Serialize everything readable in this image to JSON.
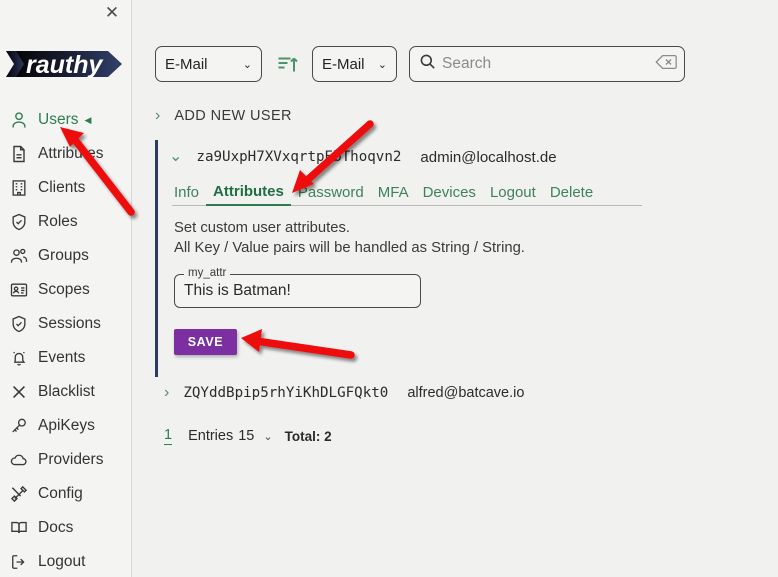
{
  "window": {
    "close_label": "✕"
  },
  "sidebar": {
    "logo_text": "rauthy",
    "items": [
      {
        "label": "Users",
        "icon": "user-icon",
        "active": true
      },
      {
        "label": "Attributes",
        "icon": "document-icon",
        "active": false
      },
      {
        "label": "Clients",
        "icon": "building-icon",
        "active": false
      },
      {
        "label": "Roles",
        "icon": "shield-check-icon",
        "active": false
      },
      {
        "label": "Groups",
        "icon": "users-icon",
        "active": false
      },
      {
        "label": "Scopes",
        "icon": "id-card-icon",
        "active": false
      },
      {
        "label": "Sessions",
        "icon": "shield-check-icon",
        "active": false
      },
      {
        "label": "Events",
        "icon": "bell-alert-icon",
        "active": false
      },
      {
        "label": "Blacklist",
        "icon": "x-icon",
        "active": false
      },
      {
        "label": "ApiKeys",
        "icon": "key-icon",
        "active": false
      },
      {
        "label": "Providers",
        "icon": "cloud-icon",
        "active": false
      },
      {
        "label": "Config",
        "icon": "tools-icon",
        "active": false
      },
      {
        "label": "Docs",
        "icon": "book-icon",
        "active": false
      },
      {
        "label": "Logout",
        "icon": "logout-icon",
        "active": false
      }
    ],
    "active_caret": "◀"
  },
  "toolbar": {
    "sort_field_value": "E-Mail",
    "sort_direction_icon": "sort-ascending-icon",
    "search_field_value": "E-Mail",
    "search_icon": "search-icon",
    "search_value": "",
    "search_placeholder": "Search",
    "search_clear_icon": "backspace-clear-icon",
    "chevron": "⌄"
  },
  "add_new_user": {
    "label": "ADD NEW USER",
    "chevron": "›"
  },
  "expanded_user": {
    "chevron": "⌄",
    "uid": "za9UxpH7XVxqrtpEbThoqvn2",
    "email": "admin@localhost.de",
    "tabs": [
      {
        "label": "Info",
        "active": false
      },
      {
        "label": "Attributes",
        "active": true
      },
      {
        "label": "Password",
        "active": false
      },
      {
        "label": "MFA",
        "active": false
      },
      {
        "label": "Devices",
        "active": false
      },
      {
        "label": "Logout",
        "active": false
      },
      {
        "label": "Delete",
        "active": false
      }
    ],
    "panel": {
      "line1": "Set custom user attributes.",
      "line2": "All Key / Value pairs will be handled as String / String.",
      "attr_label": "my_attr",
      "attr_value": "This is Batman!",
      "save_label": "SAVE"
    }
  },
  "user_row_2": {
    "chevron": "›",
    "uid": "ZQYddBpip5rhYiKhDLGFQkt0",
    "email": "alfred@batcave.io"
  },
  "pagination": {
    "page": "1",
    "entries_label": "Entries",
    "entries_count": "15",
    "chevron": "⌄",
    "total": "Total: 2"
  },
  "colors": {
    "accent_green": "#2f7d4f",
    "save_purple": "#7c2fa0",
    "card_border": "#2c3d64",
    "annotation_red": "#ee1111",
    "background": "#f1f1f0"
  }
}
